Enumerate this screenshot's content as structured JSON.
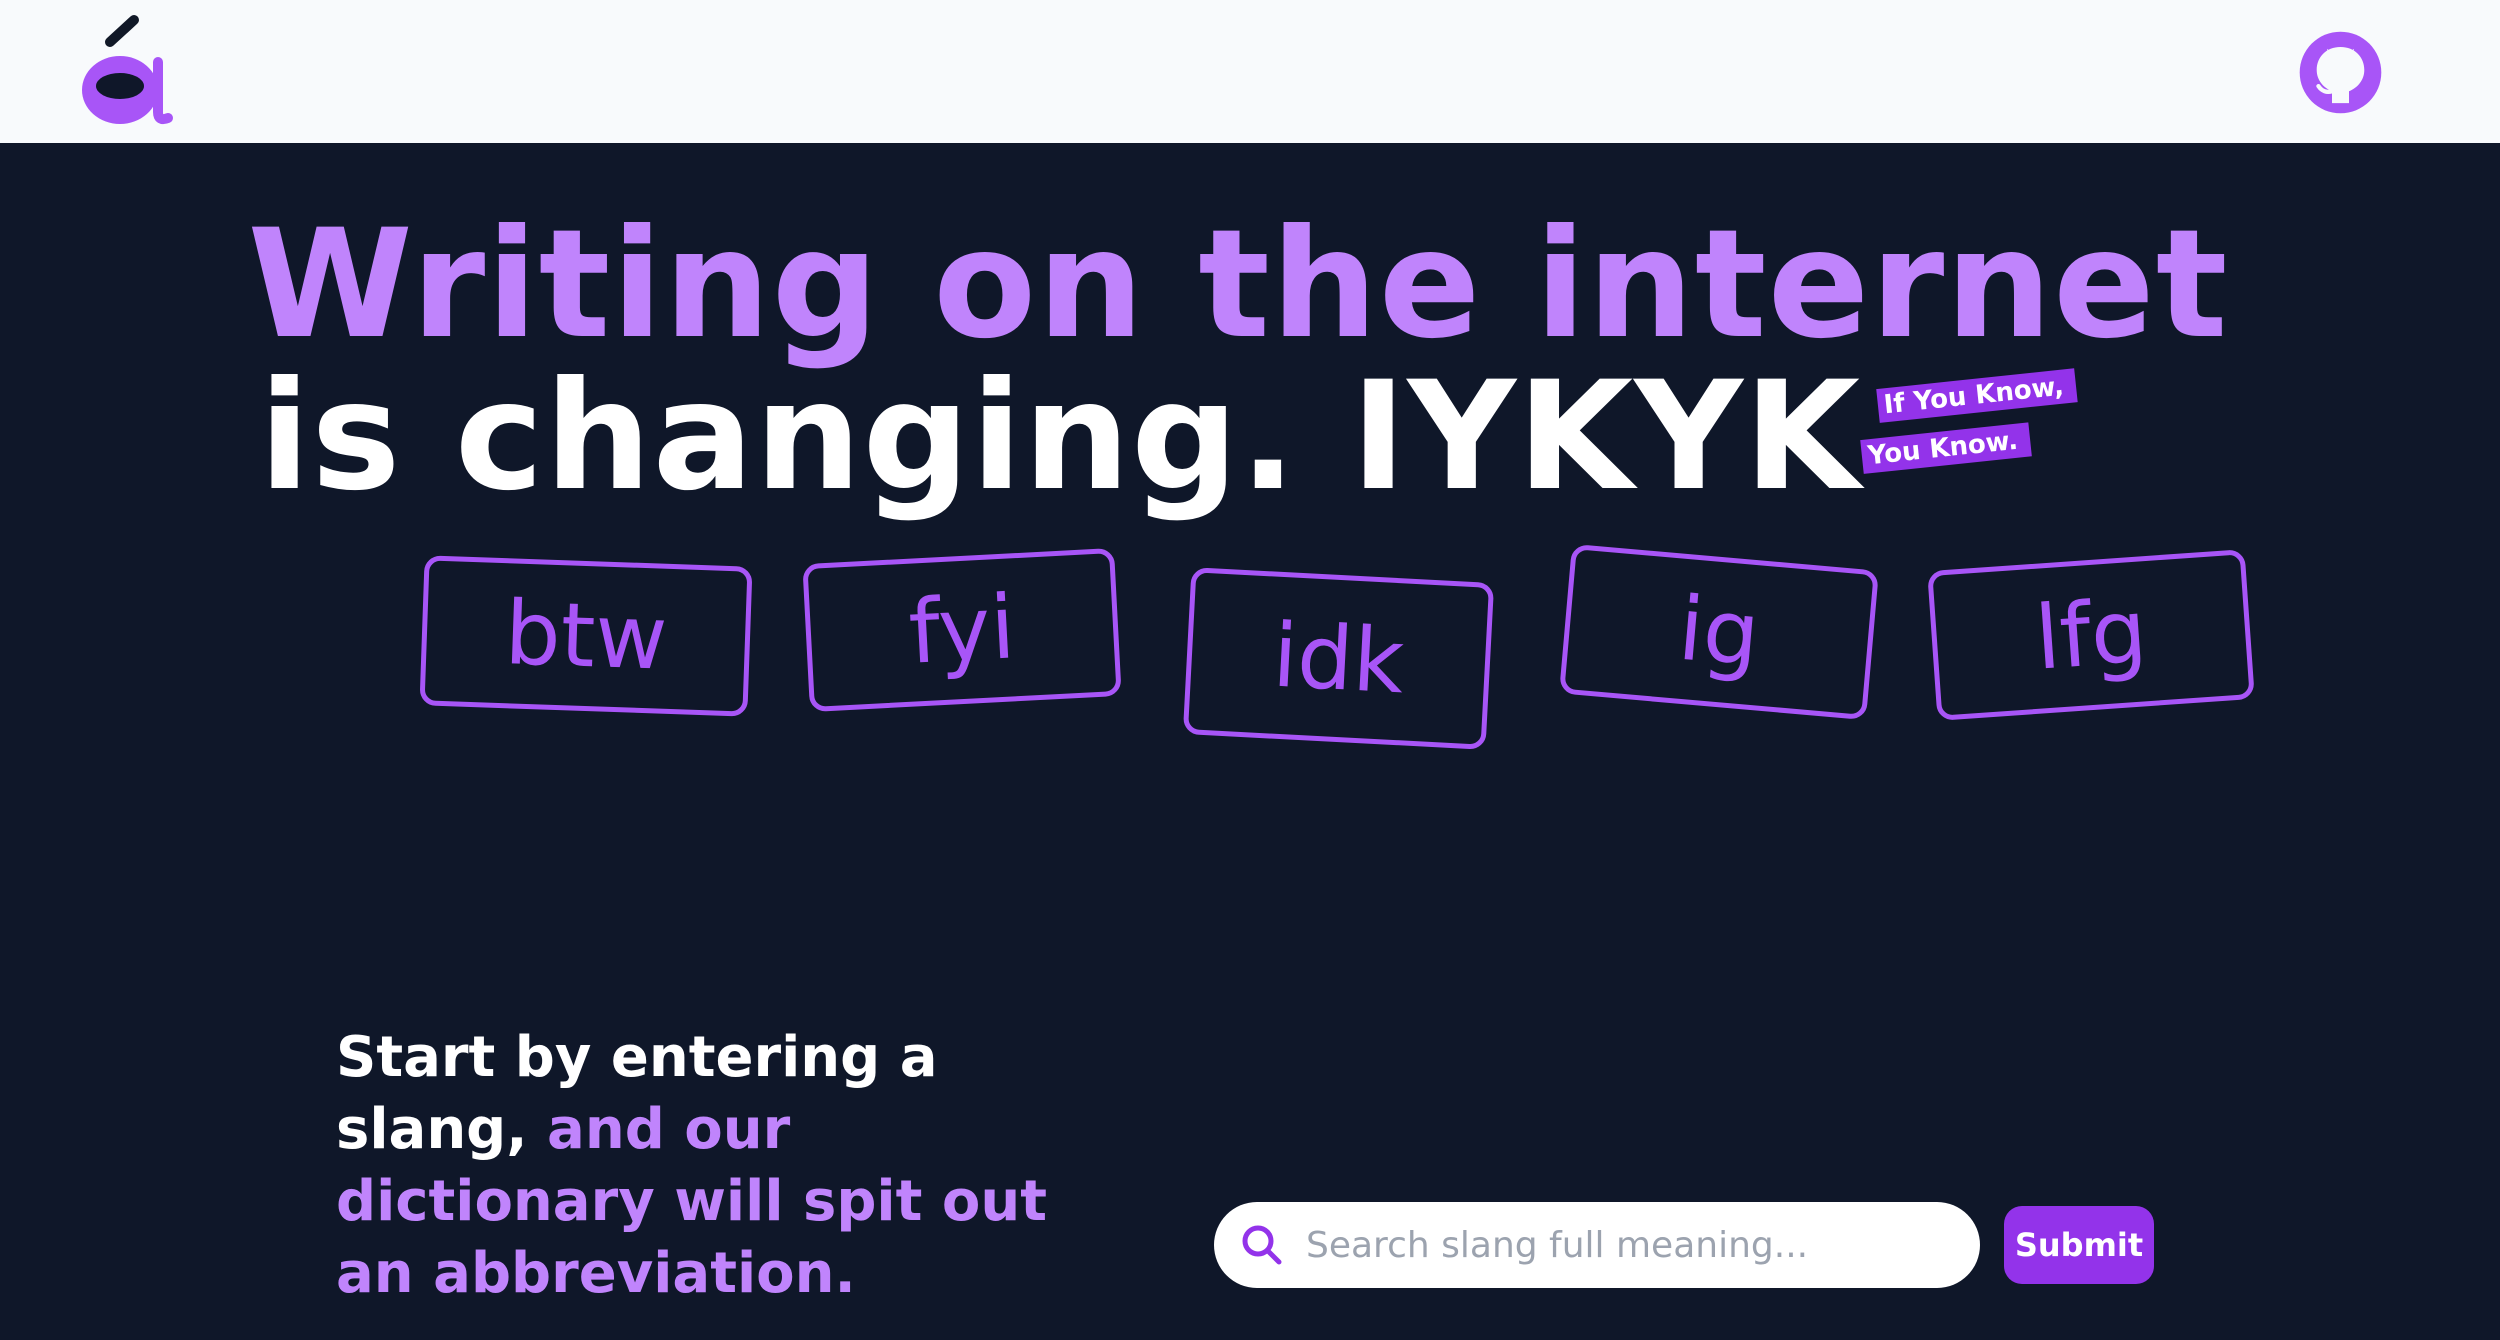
{
  "header": {
    "logo_icon": "a-acute-logo-icon",
    "github_icon": "github-icon"
  },
  "hero": {
    "line1": "Writing on the internet",
    "line2": "is changing. IYKYK",
    "badge_line1": "If You Know,",
    "badge_line2": "You Know."
  },
  "slang_chips": [
    "btw",
    "fyi",
    "idk",
    "ig",
    "lfg"
  ],
  "tagline": {
    "part1": "Start by entering a slang,",
    "part2": " and our dictionary will spit out an abbreviation."
  },
  "search": {
    "placeholder": "Search slang full meaning...",
    "value": "",
    "icon": "search-icon"
  },
  "submit_label": "Submit",
  "colors": {
    "accent": "#c084fc",
    "brand": "#9333ea",
    "background": "#0f1729",
    "header": "#f8fafc"
  }
}
